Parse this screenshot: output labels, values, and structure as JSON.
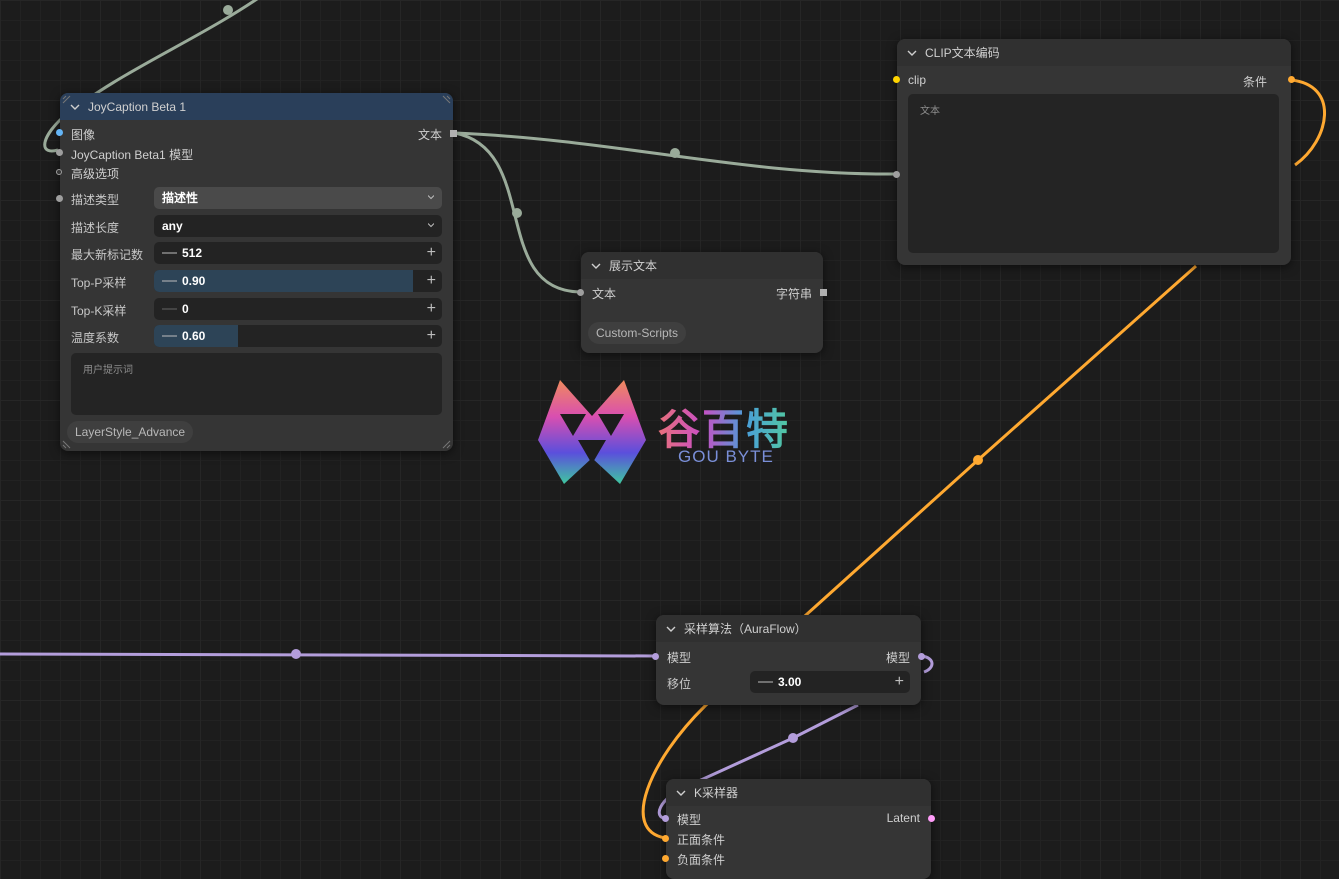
{
  "nodes": {
    "joycaption": {
      "title": "JoyCaption Beta 1",
      "inputs": [
        "图像",
        "JoyCaption Beta1 模型",
        "高级选项"
      ],
      "output": "文本",
      "widgets": {
        "desc_type": {
          "label": "描述类型",
          "value": "描述性"
        },
        "desc_length": {
          "label": "描述长度",
          "value": "any"
        },
        "max_tokens": {
          "label": "最大新标记数",
          "value": "512"
        },
        "top_p": {
          "label": "Top-P采样",
          "value": "0.90",
          "fill_fraction": 0.9
        },
        "top_k": {
          "label": "Top-K采样",
          "value": "0"
        },
        "temperature": {
          "label": "温度系数",
          "value": "0.60",
          "fill_fraction": 0.29
        }
      },
      "prompt_placeholder": "用户提示词",
      "badge": "LayerStyle_Advance"
    },
    "clip_encode": {
      "title": "CLIP文本编码",
      "input": "clip",
      "output": "条件",
      "textarea_label": "文本"
    },
    "show_text": {
      "title": "展示文本",
      "input": "文本",
      "output": "字符串",
      "badge": "Custom-Scripts"
    },
    "sampling": {
      "title": "采样算法（AuraFlow）",
      "input": "模型",
      "output": "模型",
      "widget": {
        "label": "移位",
        "value": "3.00"
      }
    },
    "ksampler": {
      "title": "K采样器",
      "inputs": [
        "模型",
        "正面条件",
        "负面条件"
      ],
      "output": "Latent"
    }
  },
  "watermark": {
    "title": "谷百特",
    "subtitle": "GOU BYTE"
  },
  "colors": {
    "canvas": "#1c1c1c",
    "node_body": "#353535",
    "joycaption_header": "#2a3f5a",
    "link_string": "#9aab9a",
    "link_conditioning": "#ffa931",
    "link_model": "#b39ddb",
    "image_slot": "#64b5f6",
    "clip_slot": "#ffd500",
    "latent_slot": "#ff9cf9"
  }
}
